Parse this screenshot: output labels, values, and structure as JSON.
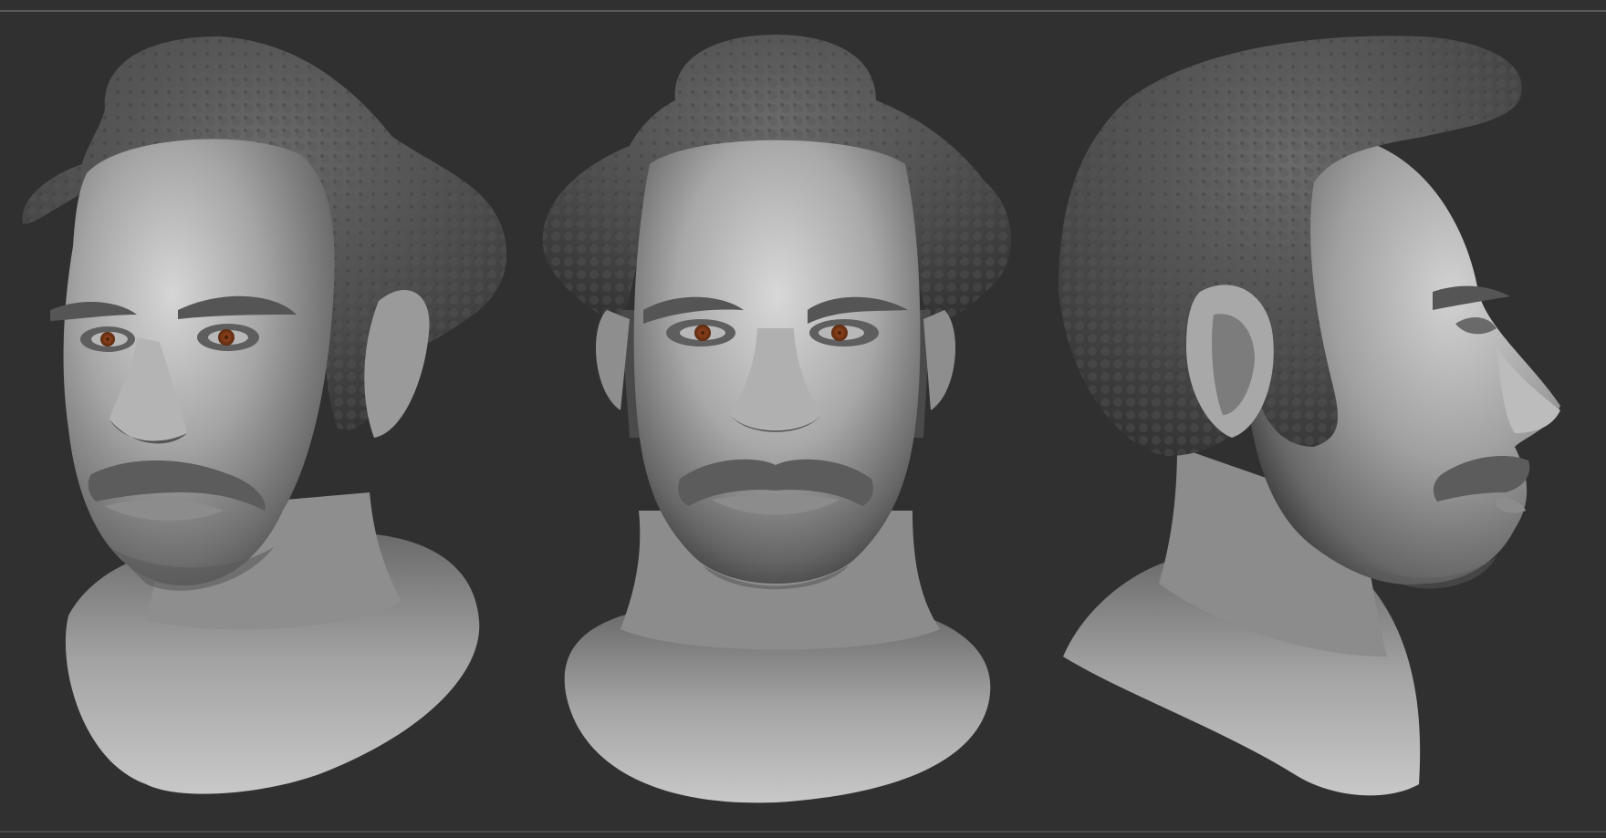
{
  "canvas": {
    "background_color": "#303030",
    "divider_color": "#5a5a5a"
  },
  "views": [
    {
      "id": "three-quarter",
      "icon": "head-sculpt-three-quarter-view"
    },
    {
      "id": "front",
      "icon": "head-sculpt-front-view"
    },
    {
      "id": "profile",
      "icon": "head-sculpt-profile-view"
    }
  ],
  "materials": {
    "clay_light": "#c9c9c9",
    "clay_mid": "#8a8a8a",
    "clay_dark": "#3c3c3c",
    "hair": "#4b4b4b",
    "iris": "#8a3f1a"
  }
}
